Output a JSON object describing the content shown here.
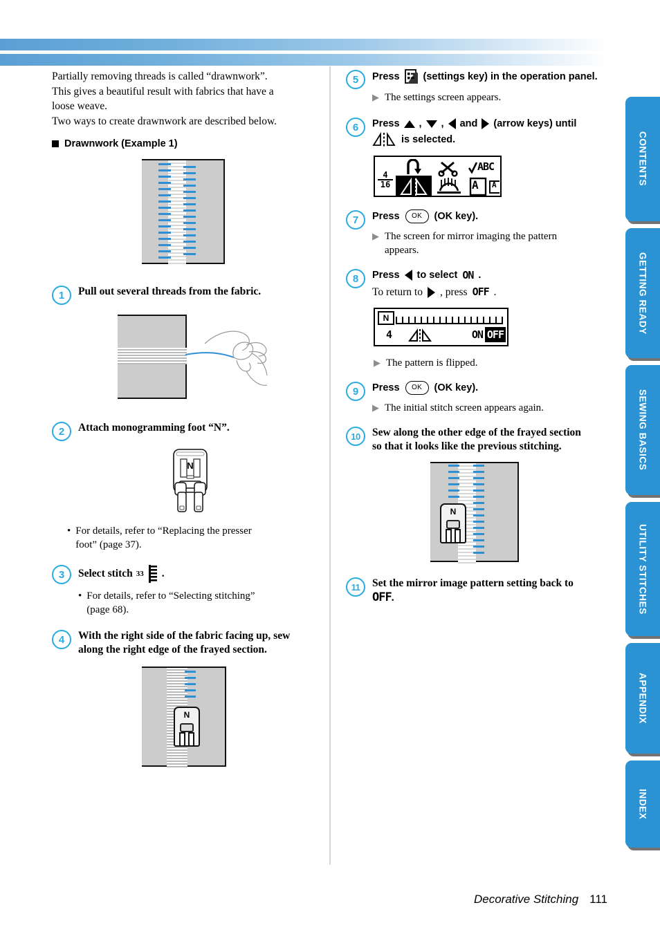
{
  "intro": {
    "lines": [
      "Partially removing threads is called “drawnwork”.",
      "This gives a beautiful result with fabrics that have a",
      "loose weave.",
      "Two ways to create drawnwork are described below."
    ],
    "section_heading": "Drawnwork (Example 1)"
  },
  "steps": {
    "s1": {
      "num": "1",
      "title": "Pull out several threads from the fabric."
    },
    "s2": {
      "num": "2",
      "title": "Attach monogramming foot “N”.",
      "bullet_1": "For details, refer to “Replacing the presser",
      "bullet_2": "foot” (page 37)."
    },
    "s3": {
      "num": "3",
      "title_a": "Select stitch",
      "stitch_number": "33",
      "title_b": ".",
      "bullet_1": "For details, refer to “Selecting stitching”",
      "bullet_2": "(page 68)."
    },
    "s4": {
      "num": "4",
      "title_1": "With the right side of the fabric facing up, sew",
      "title_2": "along the right edge of the frayed section."
    },
    "s5": {
      "num": "5",
      "title_a": "Press",
      "title_b": "(settings key) in the operation panel.",
      "result": "The settings screen appears."
    },
    "s6": {
      "num": "6",
      "title_a": "Press",
      "title_b": ",",
      "title_c": ",",
      "title_d": "and",
      "title_e": "(arrow keys) until",
      "title_f": "is selected."
    },
    "s7": {
      "num": "7",
      "title_a": "Press",
      "title_b": "(OK key).",
      "result_1": "The screen for mirror imaging the pattern",
      "result_2": "appears."
    },
    "s8": {
      "num": "8",
      "title_a": "Press",
      "title_b": "to select",
      "on_label": "ON",
      "title_c": ".",
      "sub_a": "To return to",
      "sub_b": ", press",
      "off_label": "OFF",
      "sub_c": ".",
      "result": "The pattern is flipped."
    },
    "s9": {
      "num": "9",
      "title_a": "Press",
      "title_b": "(OK key).",
      "result": "The initial stitch screen appears again."
    },
    "s10": {
      "num": "10",
      "title_1": "Sew along the other edge of the frayed section",
      "title_2": "so that it looks like the previous stitching."
    },
    "s11": {
      "num": "11",
      "title_1": "Set the mirror image pattern setting back to",
      "off_label": "OFF",
      "title_2": "."
    }
  },
  "lcd_settings": {
    "page_numerator": "4",
    "page_denominator": "16",
    "icons": [
      "needle-position-icon",
      "thread-cutter-icon",
      "check-abc-icon",
      "mirror-image-icon",
      "stitch-width-icon",
      "letter-a-icon",
      "letter-a-small-icon"
    ],
    "abc_label": "ABC",
    "letter_a": "A",
    "letter_a_small": "A",
    "selected": "mirror-image-icon"
  },
  "lcd_mirror": {
    "foot_label": "N",
    "stitch_number": "4",
    "on_label": "ON",
    "off_label": "OFF",
    "selected": "OFF"
  },
  "foot_label": "N",
  "tabs": [
    {
      "label": "CONTENTS"
    },
    {
      "label": "GETTING READY"
    },
    {
      "label": "SEWING BASICS"
    },
    {
      "label": "UTILITY STITCHES"
    },
    {
      "label": "APPENDIX"
    },
    {
      "label": "INDEX"
    }
  ],
  "footer": {
    "chapter": "Decorative Stitching",
    "page": "111"
  },
  "colors": {
    "accent_blue": "#29ABE2",
    "tab_blue": "#2b92d4",
    "stitch_blue": "#2f8fd4",
    "fabric_gray": "#cccccc"
  }
}
